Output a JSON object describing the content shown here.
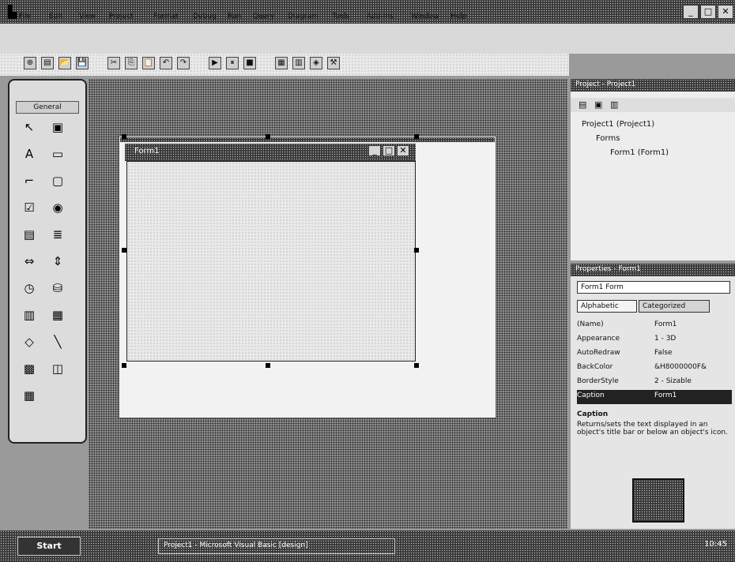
{
  "window": {
    "title": "",
    "minimize": "_",
    "maximize": "□",
    "close": "✕"
  },
  "menu": {
    "items": [
      "File",
      "Edit",
      "View",
      "Project",
      "Format",
      "Debug",
      "Run",
      "Query",
      "Diagram",
      "Tools",
      "Add-Ins",
      "Window",
      "Help"
    ]
  },
  "toolbar": {
    "icons": [
      "new-project-icon",
      "add-form-icon",
      "open-icon",
      "save-icon",
      "cut-icon",
      "copy-icon",
      "paste-icon",
      "undo-icon",
      "redo-icon",
      "run-icon",
      "pause-icon",
      "stop-icon",
      "project-explorer-icon",
      "properties-icon",
      "object-browser-icon",
      "toolbox-icon"
    ],
    "glyphs": [
      "⊕",
      "▤",
      "📂",
      "💾",
      "✂",
      "⎘",
      "📋",
      "↶",
      "↷",
      "▶",
      "⏸",
      "■",
      "▦",
      "▥",
      "◈",
      "⚒"
    ]
  },
  "toolbox": {
    "title": "General",
    "tools": [
      {
        "icon": "pointer-icon",
        "glyph": "↖"
      },
      {
        "icon": "picturebox-icon",
        "glyph": "▣"
      },
      {
        "icon": "label-icon",
        "glyph": "A"
      },
      {
        "icon": "textbox-icon",
        "glyph": "▭"
      },
      {
        "icon": "frame-icon",
        "glyph": "⌐"
      },
      {
        "icon": "commandbutton-icon",
        "glyph": "▢"
      },
      {
        "icon": "checkbox-icon",
        "glyph": "☑"
      },
      {
        "icon": "optionbutton-icon",
        "glyph": "◉"
      },
      {
        "icon": "combobox-icon",
        "glyph": "▤"
      },
      {
        "icon": "listbox-icon",
        "glyph": "≣"
      },
      {
        "icon": "hscrollbar-icon",
        "glyph": "⇔"
      },
      {
        "icon": "vscrollbar-icon",
        "glyph": "⇕"
      },
      {
        "icon": "timer-icon",
        "glyph": "◷"
      },
      {
        "icon": "drivelistbox-icon",
        "glyph": "⛁"
      },
      {
        "icon": "dirlistbox-icon",
        "glyph": "▥"
      },
      {
        "icon": "filelistbox-icon",
        "glyph": "▦"
      },
      {
        "icon": "shape-icon",
        "glyph": "◇"
      },
      {
        "icon": "line-icon",
        "glyph": "╲"
      },
      {
        "icon": "image-icon",
        "glyph": "▩"
      },
      {
        "icon": "data-icon",
        "glyph": "◫"
      },
      {
        "icon": "ole-icon",
        "glyph": "▦"
      }
    ]
  },
  "form": {
    "title": "Form1"
  },
  "project_explorer": {
    "title": "Project - Project1",
    "tree": [
      {
        "label": "Project1 (Project1)",
        "depth": 0
      },
      {
        "label": "Forms",
        "depth": 1
      },
      {
        "label": "Form1 (Form1)",
        "depth": 2
      }
    ]
  },
  "properties": {
    "title": "Properties - Form1",
    "object": "Form1 Form",
    "tabs": [
      "Alphabetic",
      "Categorized"
    ],
    "rows": [
      {
        "name": "(Name)",
        "value": "Form1"
      },
      {
        "name": "Appearance",
        "value": "1 - 3D"
      },
      {
        "name": "AutoRedraw",
        "value": "False"
      },
      {
        "name": "BackColor",
        "value": "&H8000000F&"
      },
      {
        "name": "BorderStyle",
        "value": "2 - Sizable"
      },
      {
        "name": "Caption",
        "value": "Form1"
      }
    ],
    "selected_index": 5,
    "description_title": "Caption",
    "description": "Returns/sets the text displayed in an object's title bar or below an object's icon."
  },
  "taskbar": {
    "start": "Start",
    "items": [
      "Project1 - Microsoft Visual Basic [design]"
    ],
    "clock": "10:45"
  }
}
